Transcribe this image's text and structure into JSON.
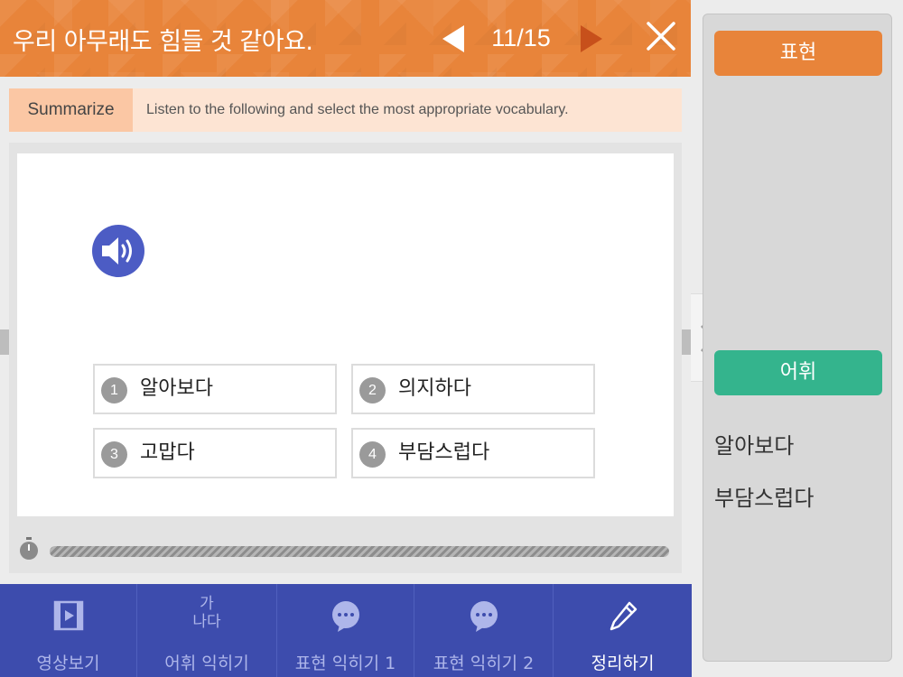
{
  "header": {
    "title": "우리 아무래도 힘들 것 같아요.",
    "page_counter": "11/15"
  },
  "instruction": {
    "tag": "Summarize",
    "text": "Listen to the following and select the most appropriate vocabulary."
  },
  "options": [
    {
      "num": "1",
      "label": "알아보다"
    },
    {
      "num": "2",
      "label": "의지하다"
    },
    {
      "num": "3",
      "label": "고맙다"
    },
    {
      "num": "4",
      "label": "부담스럽다"
    }
  ],
  "right_panel": {
    "expression_header": "표현",
    "vocab_header": "어휘",
    "vocab_items": [
      "알아보다",
      "부담스럽다"
    ]
  },
  "bottom_nav": [
    {
      "label": "영상보기",
      "icon": "video-icon"
    },
    {
      "label": "어휘 익히기",
      "icon": "ganada-icon",
      "icon_text": [
        "가",
        "나다"
      ]
    },
    {
      "label": "표현 익히기 1",
      "icon": "speech-bubble-icon"
    },
    {
      "label": "표현 익히기 2",
      "icon": "speech-bubble-icon"
    },
    {
      "label": "정리하기",
      "icon": "pencil-icon",
      "active": true
    }
  ],
  "colors": {
    "header": "#e8843a",
    "next_arrow": "#c7501b",
    "audio": "#4c5cc4",
    "vocab_header": "#34b48d",
    "nav": "#3d4cad"
  }
}
